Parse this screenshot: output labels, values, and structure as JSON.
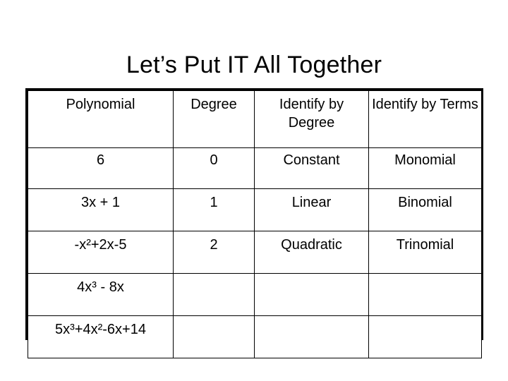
{
  "slide": {
    "title": "Let’s Put IT All Together",
    "background_color": "#ffffff",
    "text_color": "#000000"
  },
  "table": {
    "border_color": "#000000",
    "headers": [
      "Polynomial",
      "Degree",
      "Identify by Degree",
      "Identify by Terms"
    ],
    "rows": [
      {
        "polynomial": "6",
        "degree": "0",
        "identify_by_degree": "Constant",
        "identify_by_terms": "Monomial"
      },
      {
        "polynomial": "3x + 1",
        "degree": "1",
        "identify_by_degree": "Linear",
        "identify_by_terms": "Binomial"
      },
      {
        "polynomial": "-x²+2x-5",
        "degree": "2",
        "identify_by_degree": "Quadratic",
        "identify_by_terms": "Trinomial"
      },
      {
        "polynomial": "4x³ - 8x",
        "degree": "",
        "identify_by_degree": "",
        "identify_by_terms": ""
      },
      {
        "polynomial": "5x³+4x²-6x+14",
        "degree": "",
        "identify_by_degree": "",
        "identify_by_terms": ""
      }
    ]
  }
}
